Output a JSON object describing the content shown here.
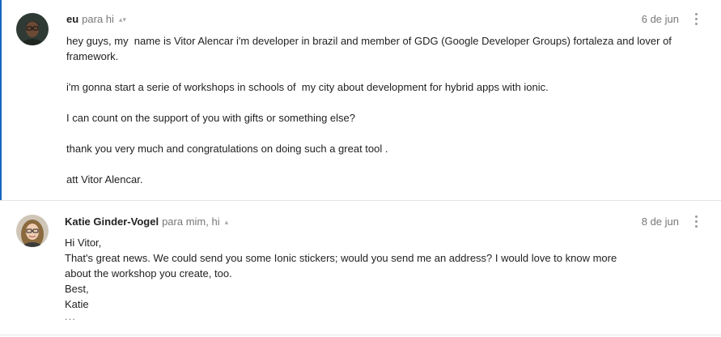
{
  "messages": [
    {
      "sender": "eu",
      "recipients": "para hi",
      "date": "6 de jun",
      "paragraphs": [
        "hey guys, my  name is Vitor Alencar i'm developer in brazil and member of GDG (Google Developer Groups) fortaleza and lover of framework.",
        "i'm gonna start a serie of workshops in schools of  my city about development for hybrid apps with ionic.",
        "I can count on the support of you with gifts or something else?",
        "thank you very much and congratulations on doing such a great tool .",
        "att Vitor Alencar."
      ]
    },
    {
      "sender": "Katie Ginder-Vogel",
      "recipients": "para mim, hi",
      "date": "8 de jun",
      "lines": [
        "Hi Vitor,",
        "That's great news. We could send you some Ionic stickers; would you send me an address? I would love to know more about the workshop you create, too.",
        "Best,",
        "Katie"
      ],
      "trimmed_indicator": "..."
    }
  ],
  "icons": {
    "recipient_details": "chevron-updown-icon",
    "more_options": "more-vert-icon"
  },
  "colors": {
    "selected_border": "#1565c0",
    "meta_text": "#777777",
    "body_text": "#222222"
  }
}
